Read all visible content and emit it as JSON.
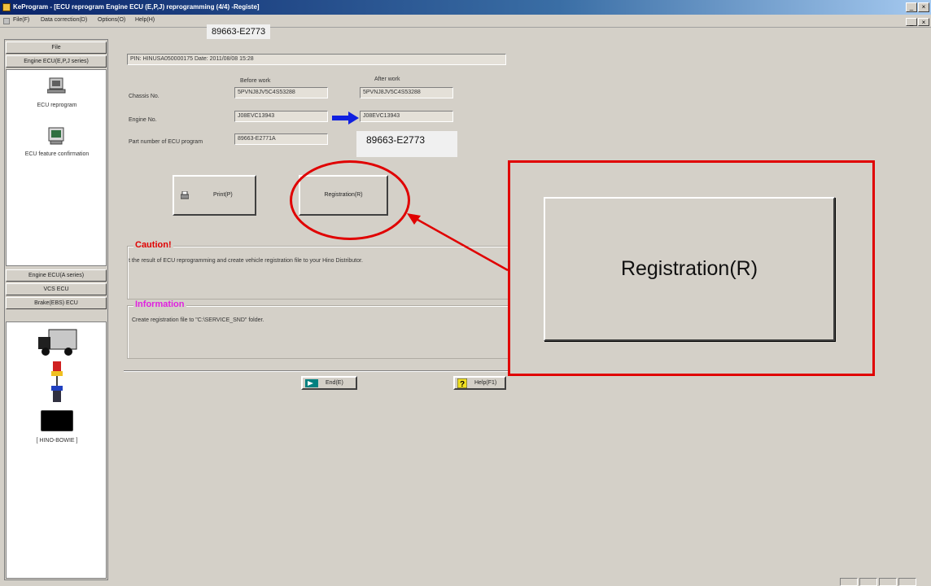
{
  "window": {
    "title": "KeProgram - [ECU reprogram Engine ECU (E,P,J) reprogramming (4/4) -Registe]",
    "minimize_glyph": "_",
    "close_glyph": "×"
  },
  "menu": {
    "items": [
      "File(F)",
      "Data correction(D)",
      "Options(O)",
      "Help(H)"
    ]
  },
  "overlay": {
    "part_top": "89663-E2773",
    "part_field": "89663-E2773"
  },
  "sidebar": {
    "file_button": "File",
    "engine_epj_button": "Engine ECU(E,P,J series)",
    "ecu_reprogram_label": "ECU reprogram",
    "ecu_feature_label": "ECU feature confirmation",
    "engine_a_button": "Engine ECU(A series)",
    "vcs_button": "VCS ECU",
    "brake_button": "Brake(EBS) ECU",
    "device_label": "[ HINO-BOWIE ]"
  },
  "main": {
    "info_line": "PIN: HINUSA050000175  Date: 2011/08/08 15:28",
    "before_header": "Before work",
    "after_header": "After work",
    "chassis_label": "Chassis No.",
    "chassis_before": "5PVNJ8JV5C4S53288",
    "chassis_after": "5PVNJ8JV5C4S53288",
    "engine_label": "Engine No.",
    "engine_before": "J08EVC13943",
    "engine_after": "J08EVC13943",
    "part_label": "Part number of ECU program",
    "part_before": "89663-E2771A",
    "print_button": "Print(P)",
    "registration_button": "Registration(R)",
    "caution_title": "Caution!",
    "caution_text": "t the result of ECU reprogramming and create vehicle registration file to your Hino Distributor.",
    "information_title": "Information",
    "information_text": "Create registration file to \"C:\\SERVICE_SND\" folder.",
    "end_button": "End(E)",
    "help_button": "Help(F1)"
  },
  "callout": {
    "zoom_label": "Registration(R)"
  },
  "colors": {
    "highlight_red": "#e00000",
    "caution_red": "#e00000",
    "information_magenta": "#e020e0",
    "arrow_blue": "#1020e0"
  }
}
